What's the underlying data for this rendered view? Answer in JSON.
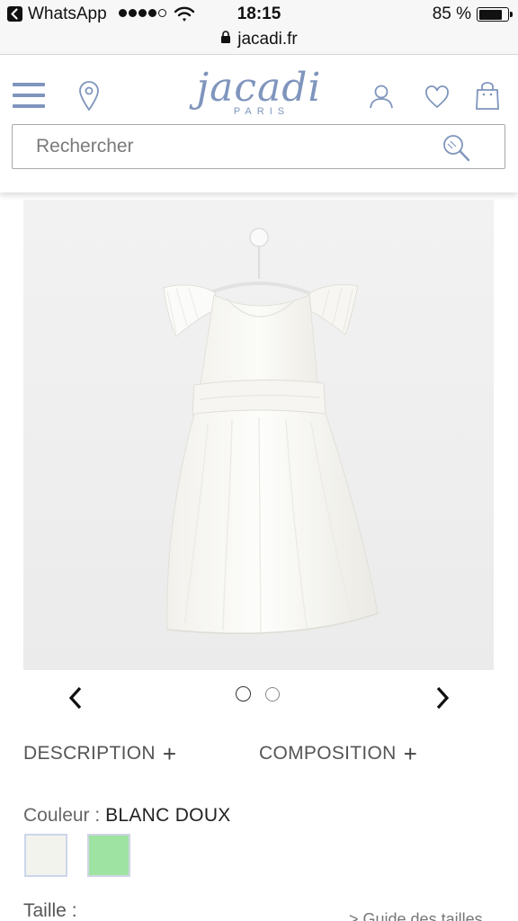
{
  "status_bar": {
    "back_app": "WhatsApp",
    "time": "18:15",
    "battery": "85 %"
  },
  "browser": {
    "url": "jacadi.fr"
  },
  "header": {
    "logo_main": "jacadi",
    "logo_sub": "PARIS",
    "search_placeholder": "Rechercher",
    "brand_color": "#7f95bd"
  },
  "carousel": {
    "dots": 2,
    "active_index": 0
  },
  "accordions": {
    "description": "DESCRIPTION",
    "composition": "COMPOSITION",
    "toggle_symbol": "+"
  },
  "product": {
    "colour_label": "Couleur :",
    "colour_value": "BLANC DOUX",
    "swatches": [
      {
        "color": "#f3f3ee",
        "selected": true
      },
      {
        "color": "#9fe3a2",
        "selected": false
      }
    ],
    "size_label": "Taille :",
    "size_guide": "> Guide des tailles"
  }
}
